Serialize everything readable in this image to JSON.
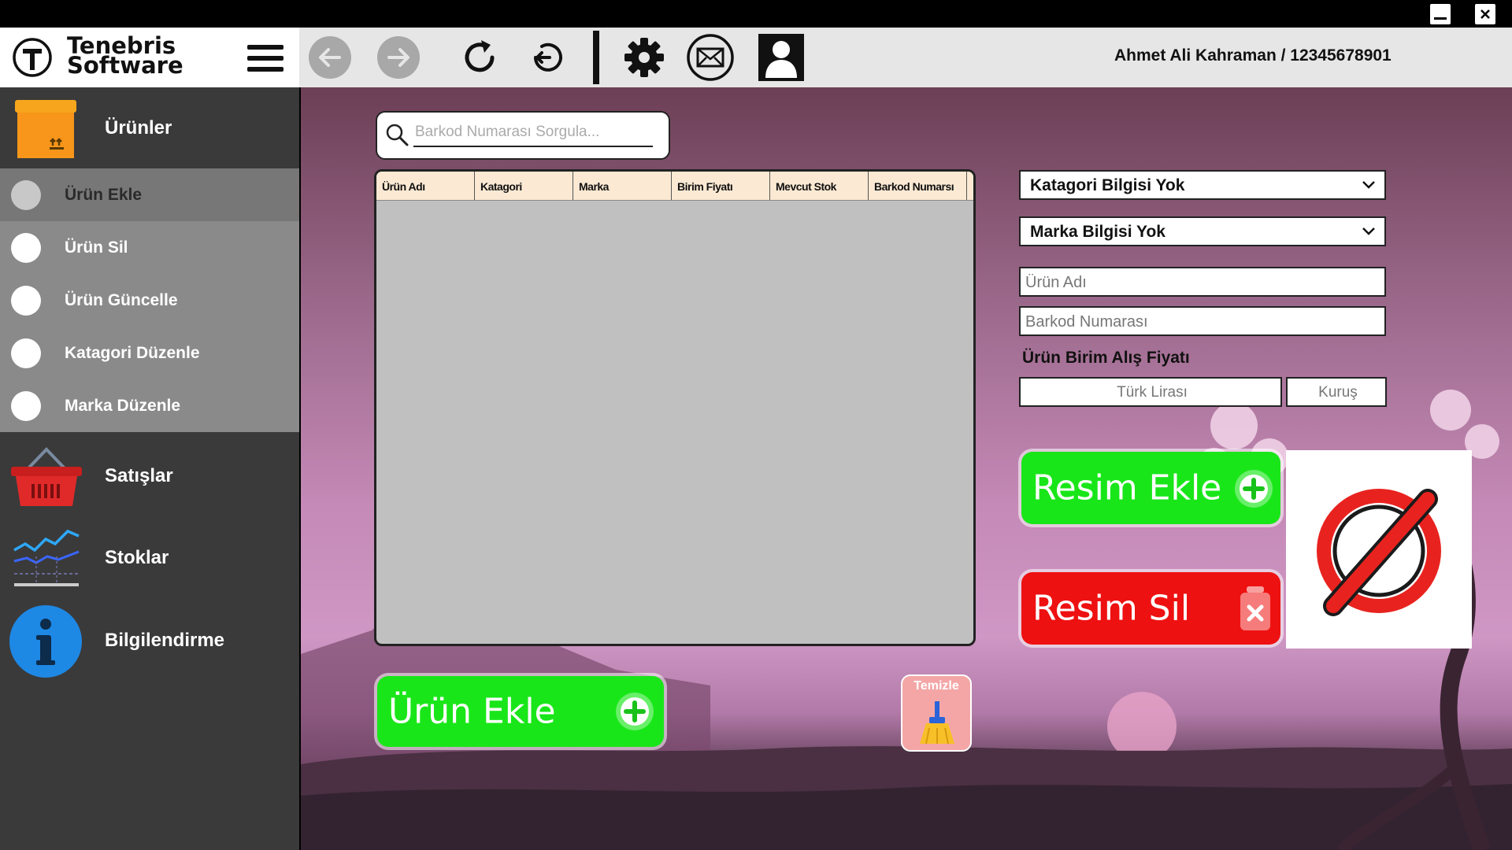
{
  "app": {
    "brand_line1": "Tenebris",
    "brand_line2": "Software",
    "user_label": "Ahmet Ali Kahraman / 12345678901"
  },
  "toolbar": {
    "icons": [
      "menu-icon",
      "back-arrow-icon",
      "forward-arrow-icon",
      "refresh-icon",
      "undo-icon",
      "gear-icon",
      "mail-icon",
      "user-avatar-icon"
    ]
  },
  "sidebar": {
    "main": [
      {
        "label": "Ürünler",
        "icon": "box-icon"
      },
      {
        "label": "Satışlar",
        "icon": "basket-icon"
      },
      {
        "label": "Stoklar",
        "icon": "chart-icon"
      },
      {
        "label": "Bilgilendirme",
        "icon": "info-icon"
      }
    ],
    "sub": [
      {
        "label": "Ürün Ekle"
      },
      {
        "label": "Ürün Sil"
      },
      {
        "label": "Ürün Güncelle"
      },
      {
        "label": "Katagori Düzenle"
      },
      {
        "label": "Marka Düzenle"
      }
    ]
  },
  "search": {
    "placeholder": "Barkod Numarası Sorgula..."
  },
  "table": {
    "columns": [
      "Ürün Adı",
      "Katagori",
      "Marka",
      "Birim Fiyatı",
      "Mevcut Stok",
      "Barkod Numarsı"
    ],
    "rows": []
  },
  "form": {
    "category_select": "Katagori Bilgisi Yok",
    "brand_select": "Marka Bilgisi Yok",
    "product_name_placeholder": "Ürün Adı",
    "barcode_placeholder": "Barkod Numarası",
    "price_label": "Ürün Birim Alış Fiyatı",
    "lira_placeholder": "Türk Lirası",
    "kurus_placeholder": "Kuruş"
  },
  "buttons": {
    "add_image": "Resim Ekle",
    "remove_image": "Resim Sil",
    "add_product": "Ürün Ekle",
    "clear": "Temizle"
  },
  "colors": {
    "green": "#19e619",
    "red": "#ee1111",
    "sidebar": "#3a3a3a",
    "submenu": "#8a8a8a"
  }
}
